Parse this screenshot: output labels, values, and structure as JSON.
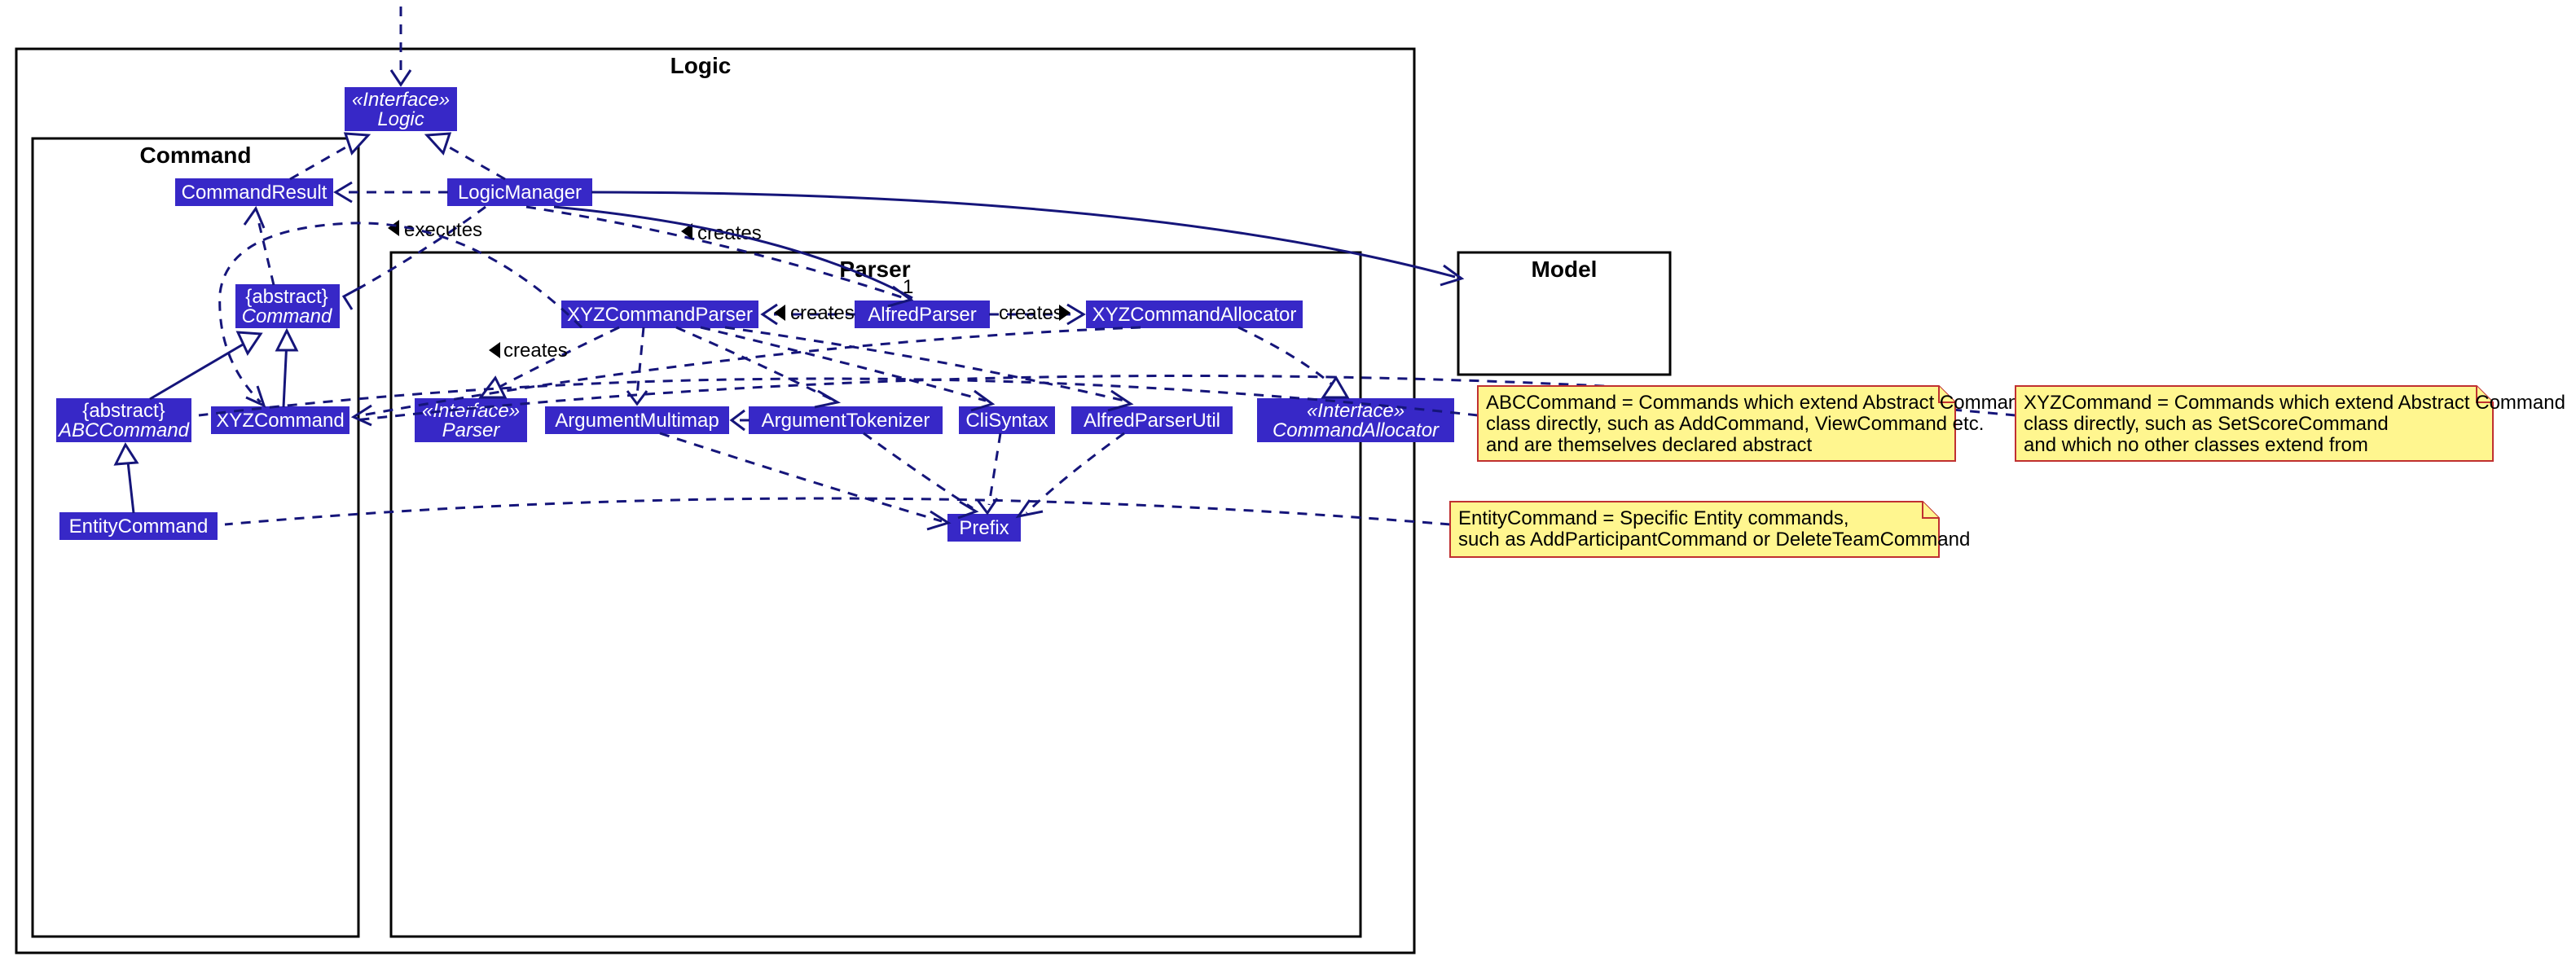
{
  "diagram_type": "UML class diagram",
  "packages": {
    "logic": {
      "title": "Logic"
    },
    "command": {
      "title": "Command"
    },
    "parser": {
      "title": "Parser"
    },
    "model": {
      "title": "Model"
    }
  },
  "classes": {
    "logic_if": {
      "stereo": "«Interface»",
      "name": "Logic"
    },
    "command_result": {
      "name": "CommandResult"
    },
    "logic_manager": {
      "name": "LogicManager"
    },
    "command_abs": {
      "stereo": "{abstract}",
      "name": "Command"
    },
    "abc_command": {
      "stereo": "{abstract}",
      "name": "ABCCommand"
    },
    "xyz_command": {
      "name": "XYZCommand"
    },
    "entity_command": {
      "name": "EntityCommand"
    },
    "xyz_cmd_parser": {
      "name": "XYZCommandParser"
    },
    "alfred_parser": {
      "name": "AlfredParser"
    },
    "xyz_cmd_alloc": {
      "name": "XYZCommandAllocator"
    },
    "parser_if": {
      "stereo": "«Interface»",
      "name": "Parser"
    },
    "arg_multimap": {
      "name": "ArgumentMultimap"
    },
    "arg_tokenizer": {
      "name": "ArgumentTokenizer"
    },
    "cli_syntax": {
      "name": "CliSyntax"
    },
    "alfred_putil": {
      "name": "AlfredParserUtil"
    },
    "cmd_alloc_if": {
      "stereo": "«Interface»",
      "name": "CommandAllocator"
    },
    "prefix": {
      "name": "Prefix"
    }
  },
  "relations": {
    "executes": "executes",
    "creates": "creates",
    "one": "1"
  },
  "notes": {
    "abc": {
      "line1": "ABCCommand = Commands which extend Abstract Command",
      "line2": " class directly, such as AddCommand, ViewCommand etc.",
      "line3": "and are themselves declared abstract"
    },
    "xyz": {
      "line1": "XYZCommand = Commands which extend Abstract Command",
      "line2": " class directly, such as SetScoreCommand",
      "line3": "and which no other classes extend from"
    },
    "entity": {
      "line1": "EntityCommand = Specific Entity commands,",
      "line2": "such as AddParticipantCommand or DeleteTeamCommand"
    }
  }
}
